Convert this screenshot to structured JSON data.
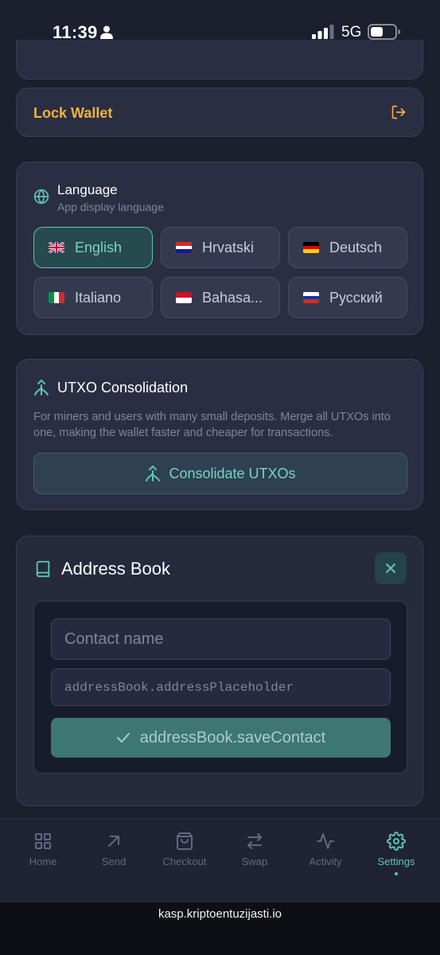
{
  "status_bar": {
    "time": "11:39",
    "network": "5G",
    "battery_level": 0.5,
    "signal_bars": 3
  },
  "lock": {
    "label": "Lock Wallet",
    "icon": "logout-icon",
    "color": "#f0b33c"
  },
  "language": {
    "title": "Language",
    "subtitle": "App display language",
    "selected": "English",
    "options": [
      {
        "label": "English",
        "flag": "gb-flag-icon"
      },
      {
        "label": "Hrvatski",
        "flag": "hr-flag-icon"
      },
      {
        "label": "Deutsch",
        "flag": "de-flag-icon"
      },
      {
        "label": "Italiano",
        "flag": "it-flag-icon"
      },
      {
        "label": "Bahasa...",
        "flag": "id-flag-icon"
      },
      {
        "label": "Русский",
        "flag": "ru-flag-icon"
      }
    ]
  },
  "utxo": {
    "title": "UTXO Consolidation",
    "description": "For miners and users with many small deposits. Merge all UTXOs into one, making the wallet faster and cheaper for transactions.",
    "button_label": "Consolidate UTXOs"
  },
  "address_book": {
    "title": "Address Book",
    "name_placeholder": "Contact name",
    "address_placeholder": "addressBook.addressPlaceholder",
    "save_label": "addressBook.saveContact"
  },
  "nav": {
    "active": "Settings",
    "items": [
      {
        "label": "Home",
        "icon": "grid-icon"
      },
      {
        "label": "Send",
        "icon": "arrow-up-right-icon"
      },
      {
        "label": "Checkout",
        "icon": "shopping-bag-icon"
      },
      {
        "label": "Swap",
        "icon": "swap-arrows-icon"
      },
      {
        "label": "Activity",
        "icon": "activity-pulse-icon"
      },
      {
        "label": "Settings",
        "icon": "gear-icon"
      }
    ]
  },
  "browser": {
    "url": "kasp.kriptoentuzijasti.io"
  },
  "colors": {
    "accent": "#5ec4b8",
    "background": "#1b1f2e",
    "card": "#2a2e43",
    "warning": "#f0b33c"
  }
}
